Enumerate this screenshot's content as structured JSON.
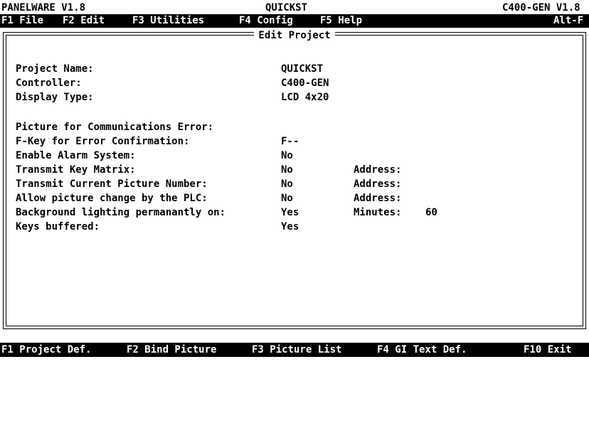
{
  "titlebar": {
    "app": "PANELWARE V1.8",
    "project": "QUICKST",
    "target": "C400-GEN V1.8"
  },
  "menubar": {
    "items": [
      "F1 File",
      "F2 Edit",
      "F3 Utilities",
      "F4 Config",
      "F5 Help"
    ],
    "shortcut": "Alt-F"
  },
  "dialog": {
    "title": "Edit Project",
    "fields": [
      {
        "label": "Project Name:",
        "value": "QUICKST"
      },
      {
        "label": "Controller:",
        "value": "C400-GEN"
      },
      {
        "label": "Display Type:",
        "value": "LCD 4x20"
      },
      {
        "label": "Picture for Communications Error:",
        "value": ""
      },
      {
        "label": "F-Key for Error Confirmation:",
        "value": "F--"
      },
      {
        "label": "Enable Alarm System:",
        "value": "No"
      },
      {
        "label": "Transmit Key Matrix:",
        "value": "No",
        "extra_label": "Address:",
        "extra_value": ""
      },
      {
        "label": "Transmit Current Picture Number:",
        "value": "No",
        "extra_label": "Address:",
        "extra_value": ""
      },
      {
        "label": "Allow picture change by the PLC:",
        "value": "No",
        "extra_label": "Address:",
        "extra_value": ""
      },
      {
        "label": "Background lighting permanantly on:",
        "value": "Yes",
        "extra_label": "Minutes:",
        "extra_value": "60"
      },
      {
        "label": "Keys buffered:",
        "value": "Yes"
      }
    ]
  },
  "statusbar": {
    "items": [
      "F1 Project Def.",
      "F2 Bind Picture",
      "F3 Picture List",
      "F4 GI Text Def.",
      "F10 Exit"
    ]
  }
}
